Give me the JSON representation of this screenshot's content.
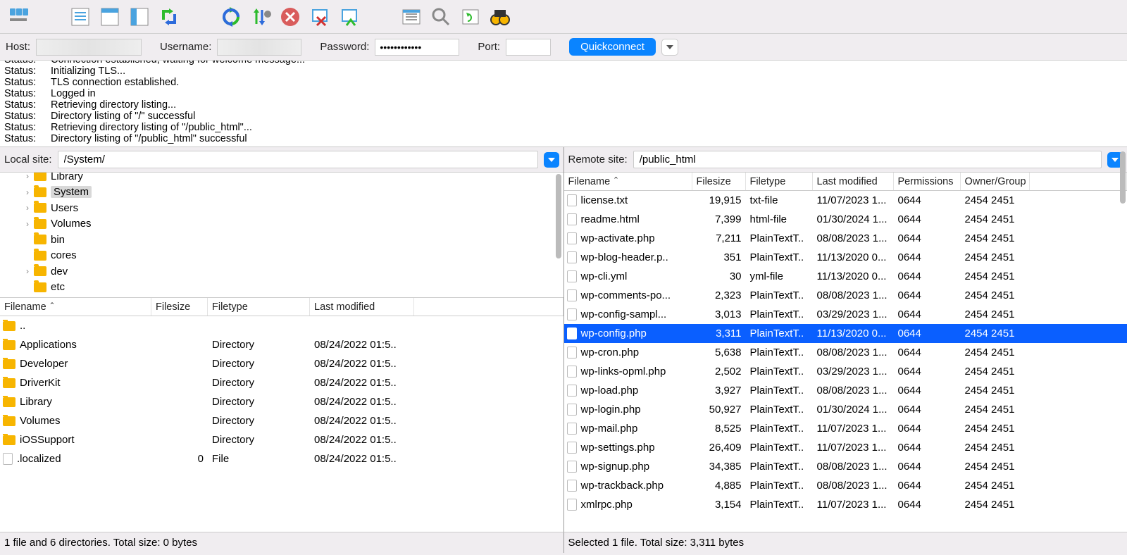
{
  "quickconnect": {
    "host_label": "Host:",
    "username_label": "Username:",
    "password_label": "Password:",
    "password_mask": "••••••••••••",
    "port_label": "Port:",
    "button": "Quickconnect"
  },
  "log_lines": [
    {
      "t": "Status:",
      "m": "Connection established, waiting for welcome message..."
    },
    {
      "t": "Status:",
      "m": "Initializing TLS..."
    },
    {
      "t": "Status:",
      "m": "TLS connection established."
    },
    {
      "t": "Status:",
      "m": "Logged in"
    },
    {
      "t": "Status:",
      "m": "Retrieving directory listing..."
    },
    {
      "t": "Status:",
      "m": "Directory listing of \"/\" successful"
    },
    {
      "t": "Status:",
      "m": "Retrieving directory listing of \"/public_html\"..."
    },
    {
      "t": "Status:",
      "m": "Directory listing of \"/public_html\" successful"
    }
  ],
  "local": {
    "site_label": "Local site:",
    "path": "/System/",
    "tree": [
      {
        "name": "Library",
        "chev": true,
        "sel": false
      },
      {
        "name": "System",
        "chev": true,
        "sel": true
      },
      {
        "name": "Users",
        "chev": true,
        "sel": false
      },
      {
        "name": "Volumes",
        "chev": true,
        "sel": false
      },
      {
        "name": "bin",
        "chev": false,
        "sel": false
      },
      {
        "name": "cores",
        "chev": false,
        "sel": false
      },
      {
        "name": "dev",
        "chev": true,
        "sel": false
      },
      {
        "name": "etc",
        "chev": false,
        "sel": false
      }
    ],
    "columns": [
      "Filename",
      "Filesize",
      "Filetype",
      "Last modified"
    ],
    "files": [
      {
        "name": "..",
        "size": "",
        "type": "",
        "mod": "",
        "icon": "folder"
      },
      {
        "name": "Applications",
        "size": "",
        "type": "Directory",
        "mod": "08/24/2022 01:5..",
        "icon": "folder"
      },
      {
        "name": "Developer",
        "size": "",
        "type": "Directory",
        "mod": "08/24/2022 01:5..",
        "icon": "folder"
      },
      {
        "name": "DriverKit",
        "size": "",
        "type": "Directory",
        "mod": "08/24/2022 01:5..",
        "icon": "folder"
      },
      {
        "name": "Library",
        "size": "",
        "type": "Directory",
        "mod": "08/24/2022 01:5..",
        "icon": "folder"
      },
      {
        "name": "Volumes",
        "size": "",
        "type": "Directory",
        "mod": "08/24/2022 01:5..",
        "icon": "folder"
      },
      {
        "name": "iOSSupport",
        "size": "",
        "type": "Directory",
        "mod": "08/24/2022 01:5..",
        "icon": "folder"
      },
      {
        "name": ".localized",
        "size": "0",
        "type": "File",
        "mod": "08/24/2022 01:5..",
        "icon": "file"
      }
    ],
    "status": "1 file and 6 directories. Total size: 0 bytes"
  },
  "remote": {
    "site_label": "Remote site:",
    "path": "/public_html",
    "columns": [
      "Filename",
      "Filesize",
      "Filetype",
      "Last modified",
      "Permissions",
      "Owner/Group"
    ],
    "files": [
      {
        "name": "license.txt",
        "size": "19,915",
        "type": "txt-file",
        "mod": "11/07/2023 1...",
        "perm": "0644",
        "own": "2454 2451",
        "sel": false
      },
      {
        "name": "readme.html",
        "size": "7,399",
        "type": "html-file",
        "mod": "01/30/2024 1...",
        "perm": "0644",
        "own": "2454 2451",
        "sel": false
      },
      {
        "name": "wp-activate.php",
        "size": "7,211",
        "type": "PlainTextT..",
        "mod": "08/08/2023 1...",
        "perm": "0644",
        "own": "2454 2451",
        "sel": false
      },
      {
        "name": "wp-blog-header.p..",
        "size": "351",
        "type": "PlainTextT..",
        "mod": "11/13/2020 0...",
        "perm": "0644",
        "own": "2454 2451",
        "sel": false
      },
      {
        "name": "wp-cli.yml",
        "size": "30",
        "type": "yml-file",
        "mod": "11/13/2020 0...",
        "perm": "0644",
        "own": "2454 2451",
        "sel": false
      },
      {
        "name": "wp-comments-po...",
        "size": "2,323",
        "type": "PlainTextT..",
        "mod": "08/08/2023 1...",
        "perm": "0644",
        "own": "2454 2451",
        "sel": false
      },
      {
        "name": "wp-config-sampl...",
        "size": "3,013",
        "type": "PlainTextT..",
        "mod": "03/29/2023 1...",
        "perm": "0644",
        "own": "2454 2451",
        "sel": false
      },
      {
        "name": "wp-config.php",
        "size": "3,311",
        "type": "PlainTextT..",
        "mod": "11/13/2020 0...",
        "perm": "0644",
        "own": "2454 2451",
        "sel": true
      },
      {
        "name": "wp-cron.php",
        "size": "5,638",
        "type": "PlainTextT..",
        "mod": "08/08/2023 1...",
        "perm": "0644",
        "own": "2454 2451",
        "sel": false
      },
      {
        "name": "wp-links-opml.php",
        "size": "2,502",
        "type": "PlainTextT..",
        "mod": "03/29/2023 1...",
        "perm": "0644",
        "own": "2454 2451",
        "sel": false
      },
      {
        "name": "wp-load.php",
        "size": "3,927",
        "type": "PlainTextT..",
        "mod": "08/08/2023 1...",
        "perm": "0644",
        "own": "2454 2451",
        "sel": false
      },
      {
        "name": "wp-login.php",
        "size": "50,927",
        "type": "PlainTextT..",
        "mod": "01/30/2024 1...",
        "perm": "0644",
        "own": "2454 2451",
        "sel": false
      },
      {
        "name": "wp-mail.php",
        "size": "8,525",
        "type": "PlainTextT..",
        "mod": "11/07/2023 1...",
        "perm": "0644",
        "own": "2454 2451",
        "sel": false
      },
      {
        "name": "wp-settings.php",
        "size": "26,409",
        "type": "PlainTextT..",
        "mod": "11/07/2023 1...",
        "perm": "0644",
        "own": "2454 2451",
        "sel": false
      },
      {
        "name": "wp-signup.php",
        "size": "34,385",
        "type": "PlainTextT..",
        "mod": "08/08/2023 1...",
        "perm": "0644",
        "own": "2454 2451",
        "sel": false
      },
      {
        "name": "wp-trackback.php",
        "size": "4,885",
        "type": "PlainTextT..",
        "mod": "08/08/2023 1...",
        "perm": "0644",
        "own": "2454 2451",
        "sel": false
      },
      {
        "name": "xmlrpc.php",
        "size": "3,154",
        "type": "PlainTextT..",
        "mod": "11/07/2023 1...",
        "perm": "0644",
        "own": "2454 2451",
        "sel": false
      }
    ],
    "status": "Selected 1 file. Total size: 3,311 bytes"
  }
}
